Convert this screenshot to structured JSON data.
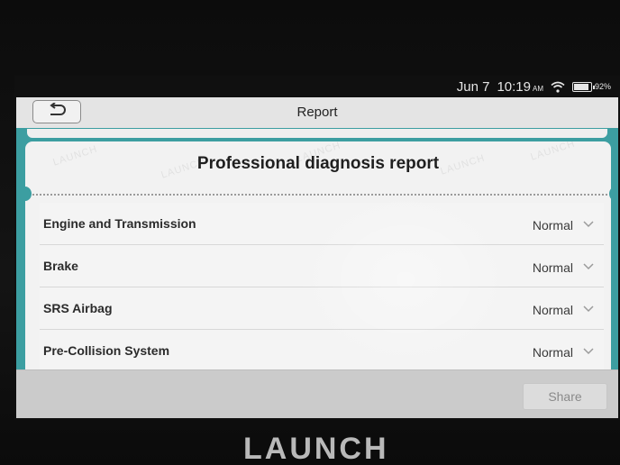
{
  "status_bar": {
    "date": "Jun 7",
    "time": "10:19",
    "ampm": "AM",
    "battery": "92%",
    "battery_level": 0.92,
    "wifi_icon": "wifi-icon"
  },
  "header": {
    "back_icon": "back-arrow-icon",
    "title": "Report"
  },
  "report": {
    "heading": "Professional diagnosis report",
    "watermark": "LAUNCH",
    "rows": [
      {
        "label": "Engine and Transmission",
        "status": "Normal"
      },
      {
        "label": "Brake",
        "status": "Normal"
      },
      {
        "label": "SRS Airbag",
        "status": "Normal"
      },
      {
        "label": "Pre-Collision System",
        "status": "Normal"
      }
    ]
  },
  "footer": {
    "share_label": "Share"
  },
  "device": {
    "brand": "LAUNCH"
  },
  "colors": {
    "accent_teal": "#3c9ea1",
    "card": "#f2f2f2"
  }
}
